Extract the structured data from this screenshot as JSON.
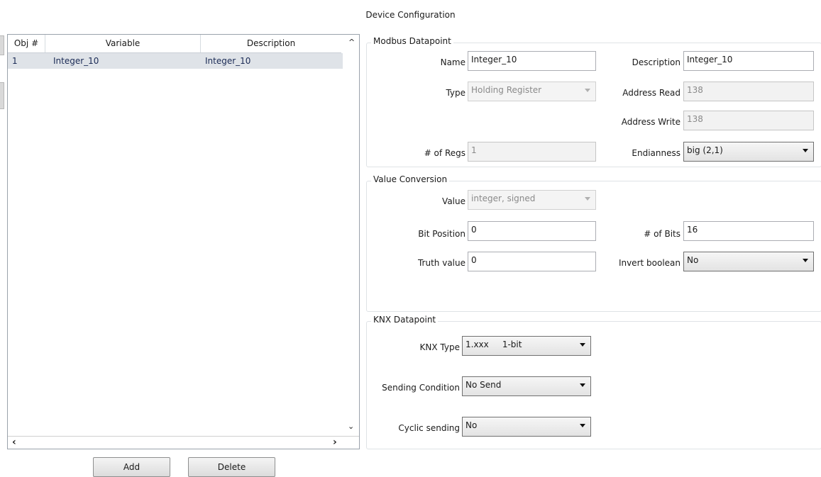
{
  "window": {
    "title": "Device Configuration"
  },
  "table": {
    "columns": [
      "Obj #",
      "Variable",
      "Description"
    ],
    "rows": [
      {
        "obj": "1",
        "variable": "Integer_10",
        "description": "Integer_10"
      }
    ],
    "scroll_up": "^",
    "scroll_down": "⌄",
    "scroll_left": "‹",
    "scroll_right": "›"
  },
  "buttons": {
    "add": "Add",
    "delete": "Delete"
  },
  "modbus": {
    "title": "Modbus Datapoint",
    "name_label": "Name",
    "name_value": "Integer_10",
    "description_label": "Description",
    "description_value": "Integer_10",
    "type_label": "Type",
    "type_value": "Holding Register",
    "address_read_label": "Address Read",
    "address_read_value": "138",
    "address_write_label": "Address Write",
    "address_write_value": "138",
    "regs_label": "# of Regs",
    "regs_value": "1",
    "endianness_label": "Endianness",
    "endianness_value": "big (2,1)"
  },
  "conversion": {
    "title": "Value Conversion",
    "value_label": "Value",
    "value_value": "integer, signed",
    "bitpos_label": "Bit Position",
    "bitpos_value": "0",
    "bits_label": "# of Bits",
    "bits_value": "16",
    "truth_label": "Truth value",
    "truth_value": "0",
    "invert_label": "Invert boolean",
    "invert_value": "No"
  },
  "knx": {
    "title": "KNX Datapoint",
    "type_label": "KNX Type",
    "type_value": "1.xxx     1-bit",
    "sending_label": "Sending Condition",
    "sending_value": "No Send",
    "cyclic_label": "Cyclic sending",
    "cyclic_value": "No"
  }
}
